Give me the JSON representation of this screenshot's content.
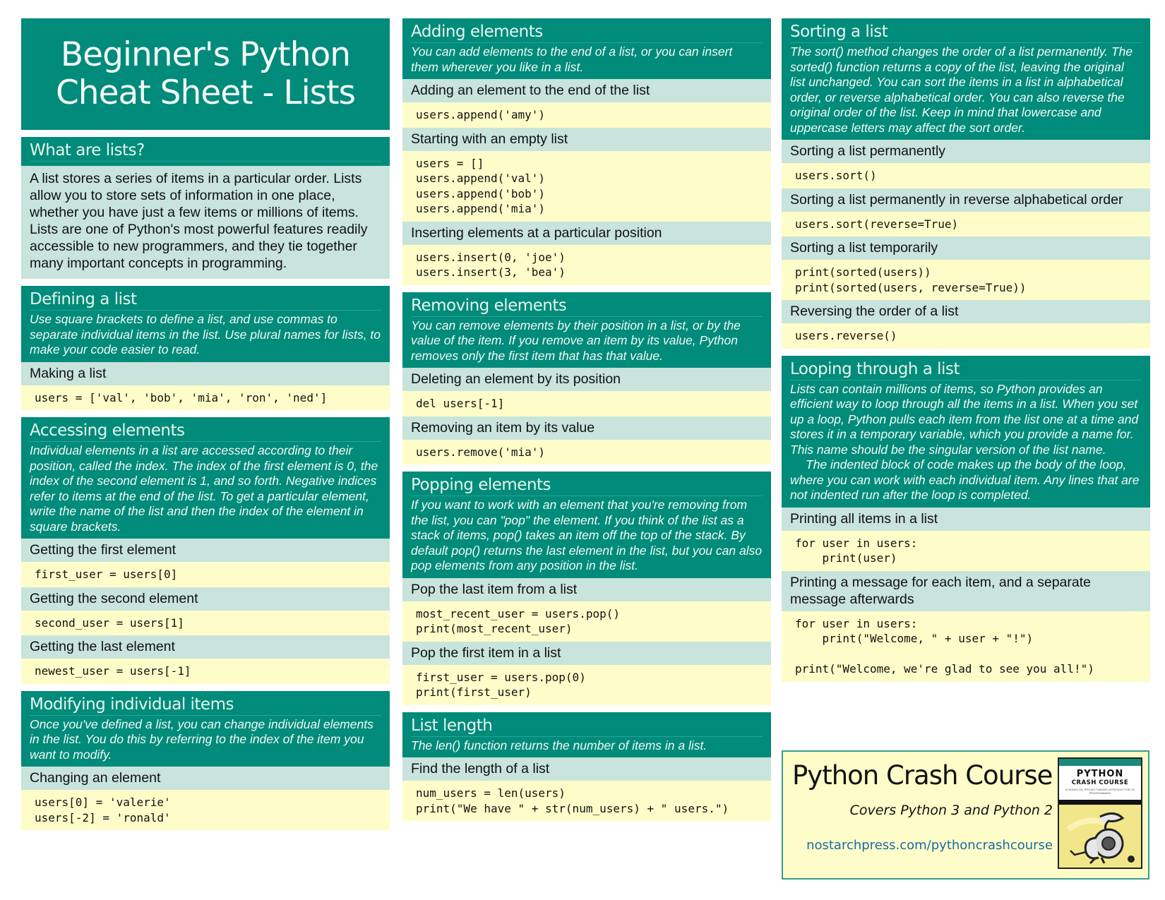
{
  "header": {
    "title_line1": "Beginner's Python",
    "title_line2": "Cheat Sheet - Lists"
  },
  "colors": {
    "section_header": "#008b7a",
    "subheading_bg": "#c8e4dc",
    "code_bg": "#fefdc9",
    "link": "#1a6aa8"
  },
  "intro": {
    "title": "What are lists?",
    "body": "A list stores a series of items in a particular order. Lists allow you to store sets of information in one place, whether you have just a few items or millions of items. Lists are one of Python's most powerful features readily accessible to new programmers, and they tie together many important concepts in programming."
  },
  "sections": {
    "defining": {
      "title": "Defining a list",
      "desc": "Use square brackets to define a list, and use commas to separate individual items in the list. Use plural names for lists, to make your code easier to read.",
      "examples": [
        {
          "label": "Making a list",
          "code": "users = ['val', 'bob', 'mia', 'ron', 'ned']"
        }
      ]
    },
    "accessing": {
      "title": "Accessing elements",
      "desc": "Individual elements in a list are accessed according to their position, called the index. The index of the first element is 0, the index of the second element is 1, and so forth. Negative indices refer to items at the end of the list. To get a particular element, write the name of the list and then the index of the element in square brackets.",
      "examples": [
        {
          "label": "Getting the first element",
          "code": "first_user = users[0]"
        },
        {
          "label": "Getting the second element",
          "code": "second_user = users[1]"
        },
        {
          "label": "Getting the last element",
          "code": "newest_user = users[-1]"
        }
      ]
    },
    "modifying": {
      "title": "Modifying individual items",
      "desc": "Once you've defined a list, you can change individual elements in the list. You do this by referring to the index of the item you want to modify.",
      "examples": [
        {
          "label": "Changing an element",
          "code": "users[0] = 'valerie'\nusers[-2] = 'ronald'"
        }
      ]
    },
    "adding": {
      "title": "Adding elements",
      "desc": "You can add elements to the end of a list, or you can insert them wherever you like in a list.",
      "examples": [
        {
          "label": "Adding an element to the end of the list",
          "code": "users.append('amy')"
        },
        {
          "label": "Starting with an empty list",
          "code": "users = []\nusers.append('val')\nusers.append('bob')\nusers.append('mia')"
        },
        {
          "label": "Inserting elements at a particular position",
          "code": "users.insert(0, 'joe')\nusers.insert(3, 'bea')"
        }
      ]
    },
    "removing": {
      "title": "Removing elements",
      "desc": "You can remove elements by their position in a list, or by the value of the item. If you remove an item by its value, Python removes only the first item that has that value.",
      "examples": [
        {
          "label": "Deleting an element by its position",
          "code": "del users[-1]"
        },
        {
          "label": "Removing an item by its value",
          "code": "users.remove('mia')"
        }
      ]
    },
    "popping": {
      "title": "Popping elements",
      "desc": "If you want to work with an element that you're removing from the list, you can \"pop\" the element. If you think of the list as a stack of items, pop() takes an item off the top of the stack. By default pop() returns the last element in the list, but you can also pop elements from any position in the list.",
      "examples": [
        {
          "label": "Pop the last item from a list",
          "code": "most_recent_user = users.pop()\nprint(most_recent_user)"
        },
        {
          "label": "Pop the first item in a list",
          "code": "first_user = users.pop(0)\nprint(first_user)"
        }
      ]
    },
    "length": {
      "title": "List length",
      "desc": "The len() function returns the number of items in a list.",
      "examples": [
        {
          "label": "Find the length of a list",
          "code": "num_users = len(users)\nprint(\"We have \" + str(num_users) + \" users.\")"
        }
      ]
    },
    "sorting": {
      "title": "Sorting a list",
      "desc": "The sort() method changes the order of a list permanently. The sorted() function returns a copy of the list, leaving the original list unchanged. You can sort the items in a list in alphabetical order, or reverse alphabetical order. You can also reverse the original order of the list. Keep in mind that lowercase and uppercase letters may affect the sort order.",
      "examples": [
        {
          "label": "Sorting a list permanently",
          "code": "users.sort()"
        },
        {
          "label": "Sorting a list permanently in reverse alphabetical order",
          "code": "users.sort(reverse=True)"
        },
        {
          "label": "Sorting a list temporarily",
          "code": "print(sorted(users))\nprint(sorted(users, reverse=True))"
        },
        {
          "label": "Reversing the order of a list",
          "code": "users.reverse()"
        }
      ]
    },
    "looping": {
      "title": "Looping through a list",
      "desc": "Lists can contain millions of items, so Python provides an efficient way to loop through all the items in a list. When you set up a loop, Python pulls each item from the list one at a time and stores it in a temporary variable, which you provide a name for. This name should be the singular version of the list name.",
      "desc2": "The indented block of code makes up the body of the loop, where you can work with each individual item. Any lines that are not indented run after the loop is completed.",
      "examples": [
        {
          "label": "Printing all items in a list",
          "code": "for user in users:\n    print(user)"
        },
        {
          "label": "Printing a message for each item, and a separate message afterwards",
          "code": "for user in users:\n    print(\"Welcome, \" + user + \"!\")\n\nprint(\"Welcome, we're glad to see you all!\")"
        }
      ]
    }
  },
  "promo": {
    "title": "Python Crash Course",
    "subtitle": "Covers Python 3 and Python 2",
    "link": "nostarchpress.com/pythoncrashcourse",
    "book_title_line1": "PYTHON",
    "book_title_line2": "CRASH COURSE",
    "book_tagline": "A HANDS-ON, PROJECT-BASED INTRODUCTION TO PROGRAMMING",
    "book_icon": "python-robot-illustration"
  }
}
